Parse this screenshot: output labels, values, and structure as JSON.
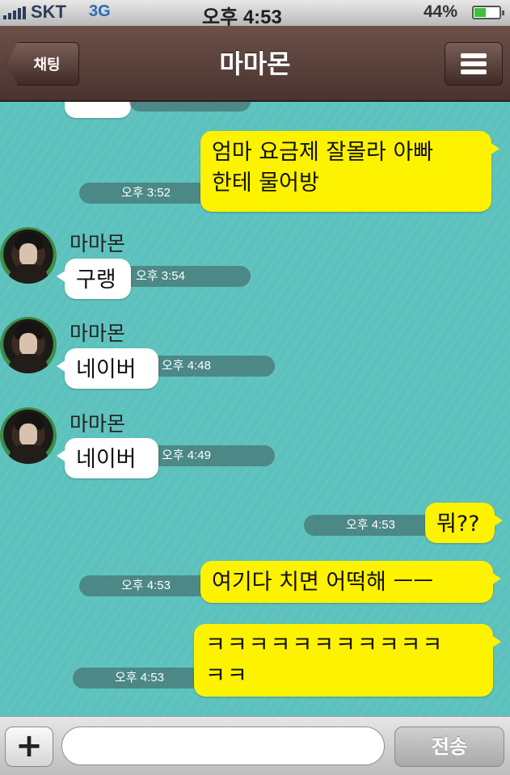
{
  "status_bar": {
    "carrier": "SKT",
    "network": "3G",
    "time": "오후 4:53",
    "battery_percent": "44%",
    "battery_level": 0.44
  },
  "nav": {
    "back_label": "채팅",
    "title": "마마몬"
  },
  "messages": [
    {
      "from": "me",
      "lines": [
        "엄마 요금제 잘몰라 아빠",
        "한테 물어방"
      ],
      "time": "오후 3:52"
    },
    {
      "from": "other",
      "sender": "마마몬",
      "text": "구랭",
      "time": "오후 3:54"
    },
    {
      "from": "other",
      "sender": "마마몬",
      "text": "네이버",
      "time": "오후 4:48"
    },
    {
      "from": "other",
      "sender": "마마몬",
      "text": "네이버",
      "time": "오후 4:49"
    },
    {
      "from": "me",
      "text": "뭐??",
      "time": "오후 4:53"
    },
    {
      "from": "me",
      "text": "여기다 치면 어떡해 ㅡㅡ",
      "time": "오후 4:53"
    },
    {
      "from": "me",
      "lines": [
        "ㅋㅋㅋㅋㅋㅋㅋㅋㅋㅋㅋ",
        "ㅋㅋ"
      ],
      "time": "오후 4:53"
    }
  ],
  "input_bar": {
    "plus_label": "+",
    "field_value": "",
    "send_label": "전송"
  },
  "colors": {
    "chat_background": "#5dc2bd",
    "my_bubble": "#fdf200",
    "their_bubble": "#ffffff",
    "nav_bar": "#5a403a"
  },
  "icons": {
    "back": "back-arrow-icon",
    "menu": "hamburger-menu-icon",
    "signal": "signal-bars-icon",
    "battery": "battery-icon",
    "attach": "plus-icon"
  }
}
